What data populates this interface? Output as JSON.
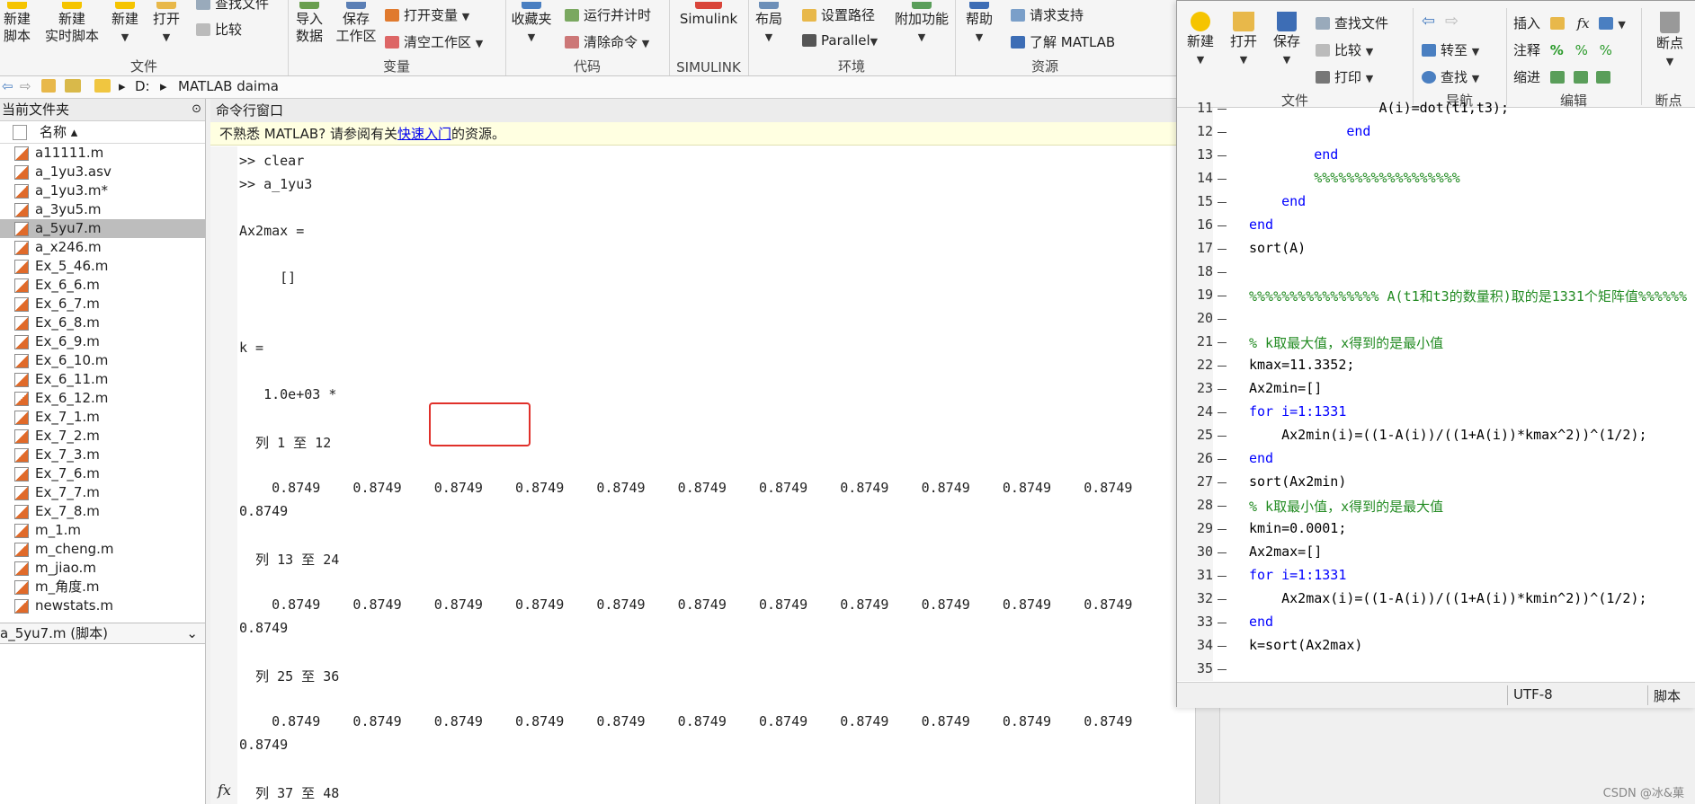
{
  "ribbon": {
    "file_group_label": "文件",
    "new_script": "新建\n脚本",
    "new_live_script": "新建\n实时脚本",
    "new": "新建",
    "open": "打开",
    "find_files": "查找文件",
    "compare": "比较",
    "var_group_label": "变量",
    "import_data": "导入\n数据",
    "save_workspace": "保存\n工作区",
    "open_variable": "打开变量",
    "clear_workspace": "清空工作区",
    "code_group_label": "代码",
    "favorites": "收藏夹",
    "run_and_time": "运行并计时",
    "clear_commands": "清除命令",
    "simulink_group_label": "SIMULINK",
    "simulink": "Simulink",
    "env_group_label": "环境",
    "layout": "布局",
    "set_path": "设置路径",
    "parallel": "Parallel",
    "addons": "附加功能",
    "resources_group_label": "资源",
    "help": "帮助",
    "request_support": "请求支持",
    "learn_matlab": "了解 MATLAB"
  },
  "address": {
    "drive": "D:",
    "folder": "MATLAB daima"
  },
  "file_panel": {
    "title": "当前文件夹",
    "column_name": "名称 ▴",
    "files": [
      "a11111.m",
      "a_1yu3.asv",
      "a_1yu3.m*",
      "a_3yu5.m",
      "a_5yu7.m",
      "a_x246.m",
      "Ex_5_46.m",
      "Ex_6_6.m",
      "Ex_6_7.m",
      "Ex_6_8.m",
      "Ex_6_9.m",
      "Ex_6_10.m",
      "Ex_6_11.m",
      "Ex_6_12.m",
      "Ex_7_1.m",
      "Ex_7_2.m",
      "Ex_7_3.m",
      "Ex_7_6.m",
      "Ex_7_7.m",
      "Ex_7_8.m",
      "m_1.m",
      "m_cheng.m",
      "m_jiao.m",
      "m_角度.m",
      "newstats.m"
    ],
    "selected_index": 4,
    "details": "a_5yu7.m  (脚本)"
  },
  "command_window": {
    "title": "命令行窗口",
    "banner_prefix": "不熟悉 MATLAB? 请参阅有关",
    "banner_link": "快速入门",
    "banner_suffix": "的资源。",
    "lines": [
      ">> clear",
      ">> a_1yu3",
      "",
      "Ax2max =",
      "",
      "     []",
      "",
      "",
      "k =",
      "",
      "   1.0e+03 *",
      "",
      "  列 1 至 12",
      "",
      "    0.8749    0.8749    0.8749    0.8749    0.8749    0.8749    0.8749    0.8749    0.8749    0.8749    0.8749",
      "0.8749",
      "",
      "  列 13 至 24",
      "",
      "    0.8749    0.8749    0.8749    0.8749    0.8749    0.8749    0.8749    0.8749    0.8749    0.8749    0.8749",
      "0.8749",
      "",
      "  列 25 至 36",
      "",
      "    0.8749    0.8749    0.8749    0.8749    0.8749    0.8749    0.8749    0.8749    0.8749    0.8749    0.8749",
      "0.8749",
      "",
      "  列 37 至 48"
    ],
    "fx_icon": "fx-icon"
  },
  "editor": {
    "toolbar": {
      "new": "新建",
      "open": "打开",
      "save": "保存",
      "find_files": "查找文件",
      "compare": "比较",
      "print": "打印",
      "file_label": "文件",
      "goto": "转至",
      "find": "查找",
      "nav_label": "导航",
      "insert": "插入",
      "comment": "注释",
      "indent": "缩进",
      "edit_label": "编辑",
      "breakpoints": "断点",
      "breakpoints_label": "断点"
    },
    "lines": [
      {
        "n": "11",
        "code": "                A(i)=dot(t1,t3);"
      },
      {
        "n": "12",
        "code": "            end"
      },
      {
        "n": "13",
        "code": "        end"
      },
      {
        "n": "14",
        "code": "        %%%%%%%%%%%%%%%%%%"
      },
      {
        "n": "15",
        "code": "    end"
      },
      {
        "n": "16",
        "code": "end"
      },
      {
        "n": "17",
        "code": "sort(A)"
      },
      {
        "n": "18",
        "code": ""
      },
      {
        "n": "19",
        "code": "%%%%%%%%%%%%%%%% A(t1和t3的数量积)取的是1331个矩阵值%%%%%%"
      },
      {
        "n": "20",
        "code": ""
      },
      {
        "n": "21",
        "code": "% k取最大值，x得到的是最小值"
      },
      {
        "n": "22",
        "code": "kmax=11.3352;"
      },
      {
        "n": "23",
        "code": "Ax2min=[]"
      },
      {
        "n": "24",
        "code": "for i=1:1331"
      },
      {
        "n": "25",
        "code": "    Ax2min(i)=((1-A(i))/((1+A(i))*kmax^2))^(1/2);"
      },
      {
        "n": "26",
        "code": "end"
      },
      {
        "n": "27",
        "code": "sort(Ax2min)"
      },
      {
        "n": "28",
        "code": "% k取最小值，x得到的是最大值"
      },
      {
        "n": "29",
        "code": "kmin=0.0001;"
      },
      {
        "n": "30",
        "code": "Ax2max=[]"
      },
      {
        "n": "31",
        "code": "for i=1:1331"
      },
      {
        "n": "32",
        "code": "    Ax2max(i)=((1-A(i))/((1+A(i))*kmin^2))^(1/2);"
      },
      {
        "n": "33",
        "code": "end"
      },
      {
        "n": "34",
        "code": "k=sort(Ax2max)"
      },
      {
        "n": "35",
        "code": ""
      }
    ],
    "encoding": "UTF-8",
    "file_type": "脚本"
  },
  "watermark": "CSDN @冰&菓",
  "colors": {
    "keyword": "#0000ff",
    "comment": "#228b22",
    "highlight_box": "#e0302a",
    "selected_row": "#bdbdbd",
    "banner_bg": "#ffffe1"
  }
}
